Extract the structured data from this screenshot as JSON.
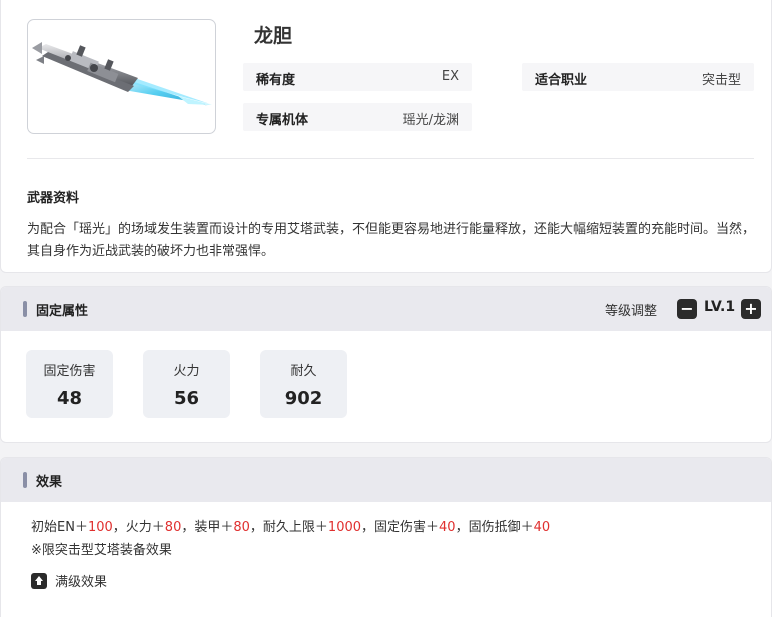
{
  "weapon": {
    "name": "龙胆",
    "image_icon": "weapon-spear-image"
  },
  "attributes": {
    "rarity": {
      "label": "稀有度",
      "value": "EX"
    },
    "class": {
      "label": "适合职业",
      "value": "突击型"
    },
    "mech": {
      "label": "专属机体",
      "value": "瑶光/龙渊"
    }
  },
  "lore": {
    "heading": "武器资料",
    "text": "为配合「瑶光」的场域发生装置而设计的专用艾塔武装，不但能更容易地进行能量释放，还能大幅缩短装置的充能时间。当然，其自身作为近战武装的破坏力也非常强悍。"
  },
  "fixed_props": {
    "title": "固定属性",
    "level_label": "等级调整",
    "minus": "−",
    "level": "LV.1",
    "plus": "+",
    "stats": [
      {
        "name": "固定伤害",
        "value": "48"
      },
      {
        "name": "火力",
        "value": "56"
      },
      {
        "name": "耐久",
        "value": "902"
      }
    ]
  },
  "effect": {
    "title": "效果",
    "line": [
      {
        "text": "初始EN＋",
        "red": false
      },
      {
        "text": "100",
        "red": true
      },
      {
        "text": "，火力＋",
        "red": false
      },
      {
        "text": "80",
        "red": true
      },
      {
        "text": "，装甲＋",
        "red": false
      },
      {
        "text": "80",
        "red": true
      },
      {
        "text": "，耐久上限＋",
        "red": false
      },
      {
        "text": "1000",
        "red": true
      },
      {
        "text": "，固定伤害＋",
        "red": false
      },
      {
        "text": "40",
        "red": true
      },
      {
        "text": "，固伤抵御＋",
        "red": false
      },
      {
        "text": "40",
        "red": true
      }
    ],
    "note": "※限突击型艾塔装备效果",
    "max_level_label": "满级效果"
  },
  "colors": {
    "accent_bar": "#8a8fa6",
    "highlight_red": "#e0302f"
  }
}
